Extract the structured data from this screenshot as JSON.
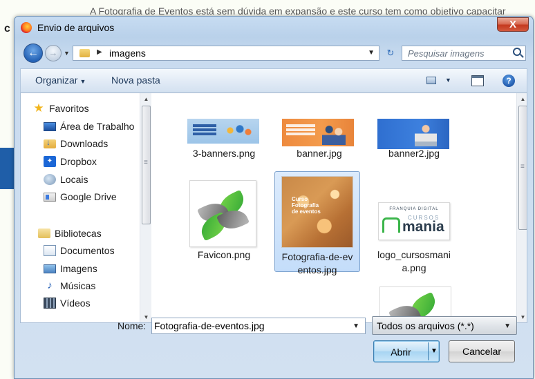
{
  "background": {
    "text": "A Fotografia de Eventos está sem dúvida em expansão e este curso tem como objetivo capacitar",
    "letter": "c"
  },
  "dialog": {
    "title": "Envio de arquivos",
    "close": "X"
  },
  "address": {
    "path": "imagens",
    "search_placeholder": "Pesquisar imagens"
  },
  "toolbar": {
    "organize": "Organizar",
    "new_folder": "Nova pasta",
    "help": "?"
  },
  "nav": {
    "favorites": [
      {
        "label": "Favoritos",
        "icon": "star-icon"
      },
      {
        "label": "Área de Trabalho",
        "icon": "desktop-icon"
      },
      {
        "label": "Downloads",
        "icon": "downloads-folder-icon"
      },
      {
        "label": "Dropbox",
        "icon": "dropbox-icon"
      },
      {
        "label": "Locais",
        "icon": "places-icon"
      },
      {
        "label": "Google Drive",
        "icon": "google-drive-icon"
      }
    ],
    "libraries": [
      {
        "label": "Bibliotecas",
        "icon": "libraries-icon"
      },
      {
        "label": "Documentos",
        "icon": "documents-icon"
      },
      {
        "label": "Imagens",
        "icon": "images-icon"
      },
      {
        "label": "Músicas",
        "icon": "music-icon"
      },
      {
        "label": "Vídeos",
        "icon": "videos-icon"
      }
    ]
  },
  "files": [
    {
      "name": "3-banners.png",
      "selected": false
    },
    {
      "name": "banner.jpg",
      "selected": false
    },
    {
      "name": "banner2.jpg",
      "selected": false
    },
    {
      "name": "Favicon.png",
      "selected": false
    },
    {
      "name_line1": "Fotografia-de-ev",
      "name_line2": "entos.jpg",
      "selected": true,
      "thumb_text": "Curso Fotografia de eventos"
    },
    {
      "name_line1": "logo_cursosmani",
      "name_line2": "a.png",
      "selected": false,
      "logo_franquia": "FRANQUIA DIGITAL",
      "logo_cursos": "CURSOS",
      "logo_mania": "mania"
    }
  ],
  "bottom": {
    "name_label": "Nome:",
    "name_value": "Fotografia-de-eventos.jpg",
    "type_value": "Todos os arquivos (*.*)",
    "open": "Abrir",
    "cancel": "Cancelar"
  },
  "colors": {
    "accent": "#2563b6",
    "selection": "#c4ddfa",
    "close": "#c4391f"
  }
}
